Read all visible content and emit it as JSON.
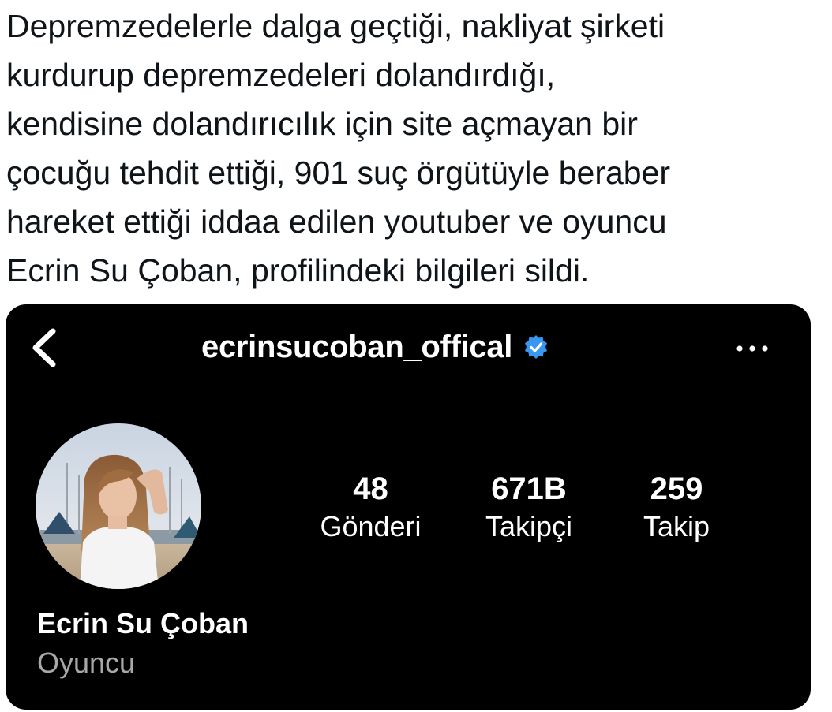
{
  "tweet": {
    "lines": [
      "Depremzedelerle dalga geçtiği, nakliyat şirketi",
      "kurdurup depremzedeleri dolandırdığı,",
      "kendisine dolandırıcılık için site açmayan bir",
      "çocuğu tehdit ettiği, 901 suç örgütüyle beraber",
      "hareket ettiği iddaa edilen youtuber ve oyuncu",
      "Ecrin Su Çoban, profilindeki bilgileri sildi."
    ]
  },
  "profile": {
    "username": "ecrinsucoban_offical",
    "verified": true,
    "back_icon": "chevron-left-icon",
    "more_icon": "more-horizontal-icon",
    "stats": [
      {
        "value": "48",
        "label": "Gönderi"
      },
      {
        "value": "671B",
        "label": "Takipçi"
      },
      {
        "value": "259",
        "label": "Takip"
      }
    ],
    "display_name": "Ecrin Su Çoban",
    "category": "Oyuncu"
  },
  "colors": {
    "text": "#0f1419",
    "panel_bg": "#000000",
    "panel_text": "#ffffff",
    "category_text": "#a8a8a8",
    "verified_badge": "#3897f0"
  }
}
